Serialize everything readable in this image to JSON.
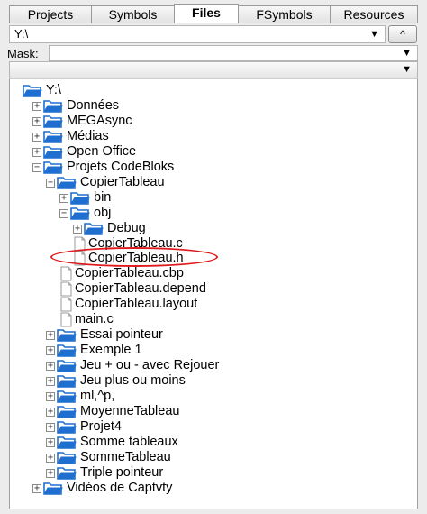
{
  "tabs": [
    {
      "label": "Projects"
    },
    {
      "label": "Symbols"
    },
    {
      "label": "Files",
      "active": true
    },
    {
      "label": "FSymbols"
    },
    {
      "label": "Resources"
    }
  ],
  "path": {
    "value": "Y:\\",
    "up_label": "^"
  },
  "mask": {
    "label": "Mask:",
    "value": ""
  },
  "tree": [
    {
      "label": "Y:\\",
      "type": "folder",
      "depth": 0,
      "expander": ""
    },
    {
      "label": "Données",
      "type": "folder",
      "depth": 1,
      "expander": "+"
    },
    {
      "label": "MEGAsync",
      "type": "folder",
      "depth": 1,
      "expander": "+"
    },
    {
      "label": "Médias",
      "type": "folder",
      "depth": 1,
      "expander": "+"
    },
    {
      "label": "Open Office",
      "type": "folder",
      "depth": 1,
      "expander": "+"
    },
    {
      "label": "Projets CodeBloks",
      "type": "folder",
      "depth": 1,
      "expander": "-"
    },
    {
      "label": "CopierTableau",
      "type": "folder",
      "depth": 2,
      "expander": "-"
    },
    {
      "label": "bin",
      "type": "folder",
      "depth": 3,
      "expander": "+"
    },
    {
      "label": "obj",
      "type": "folder",
      "depth": 3,
      "expander": "-"
    },
    {
      "label": "Debug",
      "type": "folder",
      "depth": 4,
      "expander": "+"
    },
    {
      "label": "CopierTableau.c",
      "type": "file",
      "depth": 5,
      "expander": ""
    },
    {
      "label": "CopierTableau.h",
      "type": "file",
      "depth": 5,
      "expander": "",
      "highlighted": true
    },
    {
      "label": "CopierTableau.cbp",
      "type": "file",
      "depth": 3,
      "expander": ""
    },
    {
      "label": "CopierTableau.depend",
      "type": "file",
      "depth": 3,
      "expander": ""
    },
    {
      "label": "CopierTableau.layout",
      "type": "file",
      "depth": 3,
      "expander": ""
    },
    {
      "label": "main.c",
      "type": "file",
      "depth": 3,
      "expander": ""
    },
    {
      "label": "Essai pointeur",
      "type": "folder",
      "depth": 2,
      "expander": "+"
    },
    {
      "label": "Exemple 1",
      "type": "folder",
      "depth": 2,
      "expander": "+"
    },
    {
      "label": "Jeu + ou - avec Rejouer",
      "type": "folder",
      "depth": 2,
      "expander": "+"
    },
    {
      "label": "Jeu plus ou moins",
      "type": "folder",
      "depth": 2,
      "expander": "+"
    },
    {
      "label": "ml,^p,",
      "type": "folder",
      "depth": 2,
      "expander": "+"
    },
    {
      "label": "MoyenneTableau",
      "type": "folder",
      "depth": 2,
      "expander": "+"
    },
    {
      "label": "Projet4",
      "type": "folder",
      "depth": 2,
      "expander": "+"
    },
    {
      "label": "Somme tableaux",
      "type": "folder",
      "depth": 2,
      "expander": "+"
    },
    {
      "label": "SommeTableau",
      "type": "folder",
      "depth": 2,
      "expander": "+"
    },
    {
      "label": "Triple pointeur",
      "type": "folder",
      "depth": 2,
      "expander": "+"
    },
    {
      "label": "Vidéos de Captvty",
      "type": "folder",
      "depth": 1,
      "expander": "+"
    }
  ],
  "colors": {
    "folder": "#1f6fd1",
    "highlight": "#e0191c"
  }
}
